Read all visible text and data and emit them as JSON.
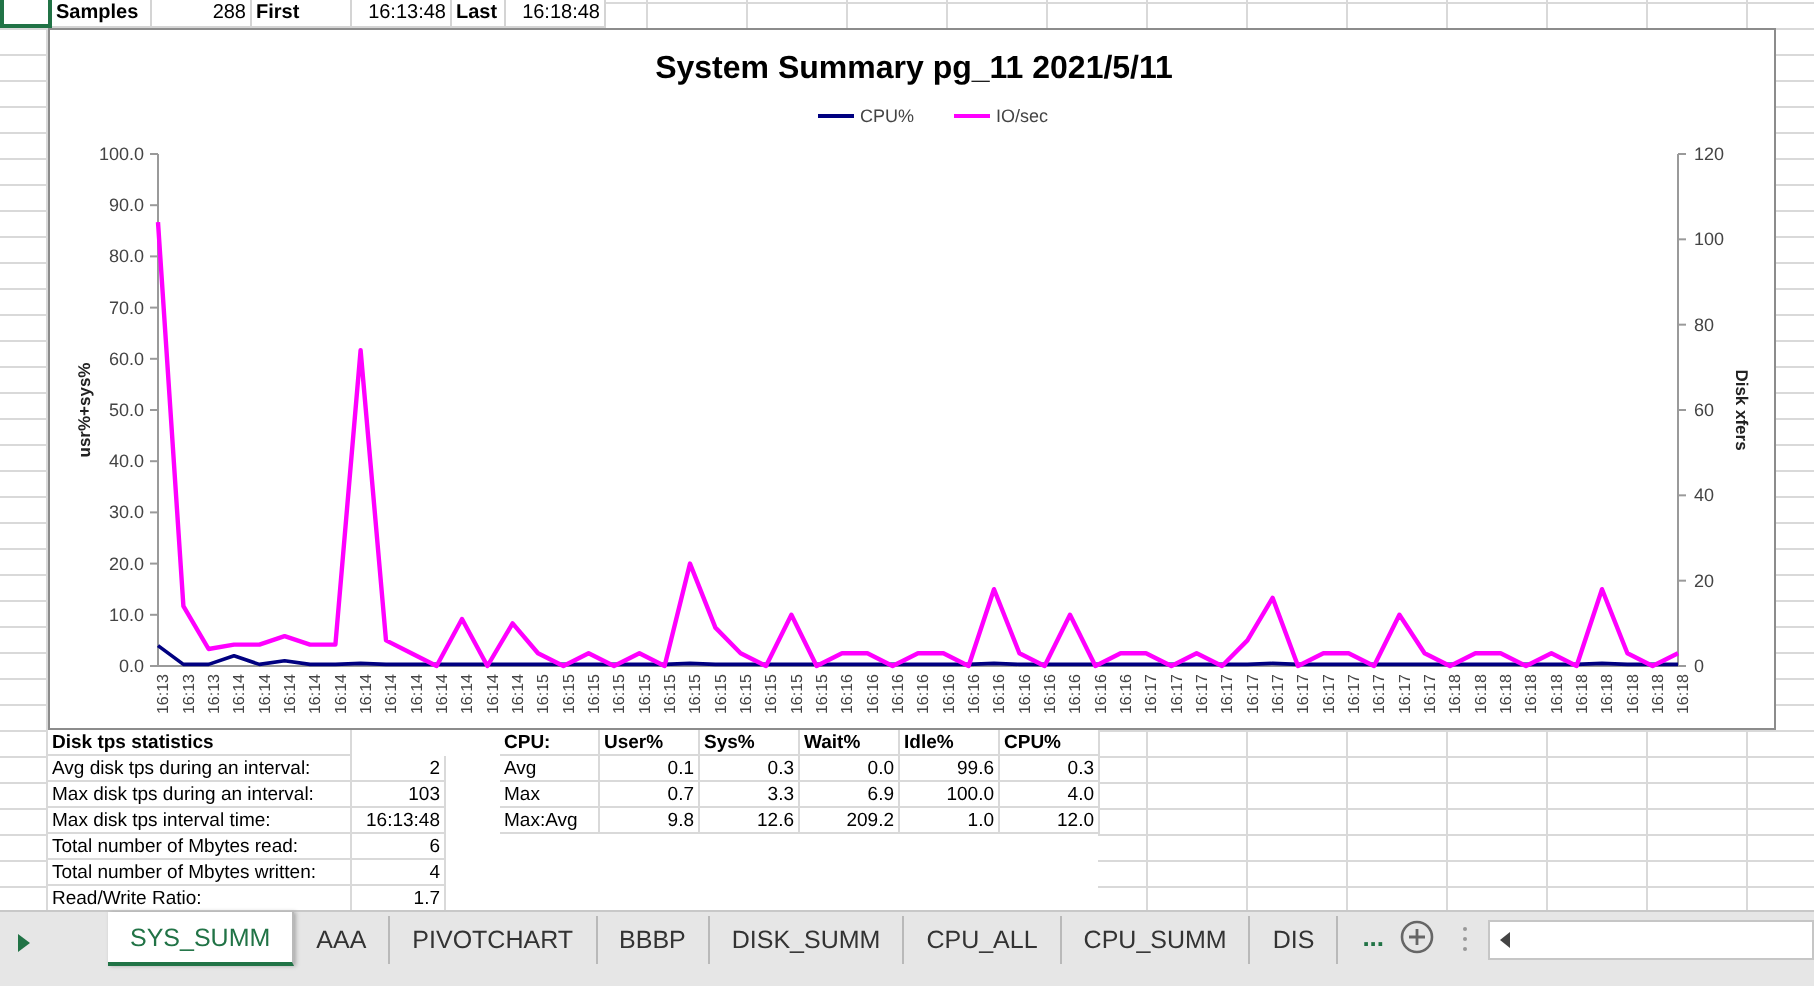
{
  "summary_row": [
    {
      "kind": "label",
      "text": "Samples"
    },
    {
      "kind": "value",
      "text": "288"
    },
    {
      "kind": "label",
      "text": "First"
    },
    {
      "kind": "value",
      "text": "16:13:48"
    },
    {
      "kind": "label",
      "text": "Last"
    },
    {
      "kind": "value",
      "text": "16:18:48"
    }
  ],
  "chart": {
    "chart_data": {
      "type": "line",
      "title": "System Summary pg_11  2021/5/11",
      "ylabel": "usr%+sys%",
      "ylim": [
        0,
        100
      ],
      "legend": "top",
      "y2label": "Disk xfers",
      "y2lim": [
        0,
        120
      ],
      "y2ticks": [
        0,
        20,
        40,
        60,
        80,
        100,
        120
      ],
      "yticks": [
        {
          "value": 0,
          "label": "0.0"
        },
        {
          "value": 10,
          "label": "10.0"
        },
        {
          "value": 20,
          "label": "20.0"
        },
        {
          "value": 30,
          "label": "30.0"
        },
        {
          "value": 40,
          "label": "40.0"
        },
        {
          "value": 50,
          "label": "50.0"
        },
        {
          "value": 60,
          "label": "60.0"
        },
        {
          "value": 70,
          "label": "70.0"
        },
        {
          "value": 80,
          "label": "80.0"
        },
        {
          "value": 90,
          "label": "90.0"
        },
        {
          "value": 100,
          "label": "100.0"
        }
      ],
      "categories": [
        "16:13",
        "16:13",
        "16:13",
        "16:14",
        "16:14",
        "16:14",
        "16:14",
        "16:14",
        "16:14",
        "16:14",
        "16:14",
        "16:14",
        "16:14",
        "16:14",
        "16:14",
        "16:15",
        "16:15",
        "16:15",
        "16:15",
        "16:15",
        "16:15",
        "16:15",
        "16:15",
        "16:15",
        "16:15",
        "16:15",
        "16:15",
        "16:16",
        "16:16",
        "16:16",
        "16:16",
        "16:16",
        "16:16",
        "16:16",
        "16:16",
        "16:16",
        "16:16",
        "16:16",
        "16:16",
        "16:17",
        "16:17",
        "16:17",
        "16:17",
        "16:17",
        "16:17",
        "16:17",
        "16:17",
        "16:17",
        "16:17",
        "16:17",
        "16:17",
        "16:18",
        "16:18",
        "16:18",
        "16:18",
        "16:18",
        "16:18",
        "16:18",
        "16:18",
        "16:18",
        "16:18"
      ],
      "series": [
        {
          "name": "CPU%",
          "color": "#000080",
          "values": [
            4,
            0.3,
            0.3,
            2,
            0.3,
            1,
            0.3,
            0.3,
            0.5,
            0.3,
            0.3,
            0.3,
            0.3,
            0.3,
            0.3,
            0.3,
            0.3,
            0.3,
            0.3,
            0.3,
            0.3,
            0.5,
            0.3,
            0.3,
            0.3,
            0.3,
            0.3,
            0.3,
            0.3,
            0.3,
            0.3,
            0.3,
            0.3,
            0.5,
            0.3,
            0.3,
            0.3,
            0.3,
            0.3,
            0.3,
            0.3,
            0.3,
            0.3,
            0.3,
            0.5,
            0.3,
            0.3,
            0.3,
            0.3,
            0.3,
            0.3,
            0.3,
            0.3,
            0.3,
            0.3,
            0.3,
            0.3,
            0.5,
            0.3,
            0.3,
            0.3
          ]
        },
        {
          "name": "IO/sec",
          "color": "#ff00ff",
          "axis": "y2",
          "values": [
            104,
            14,
            4,
            5,
            5,
            7,
            5,
            5,
            74,
            6,
            3,
            0,
            11,
            0,
            10,
            3,
            0,
            3,
            0,
            3,
            0,
            24,
            9,
            3,
            0,
            12,
            0,
            3,
            3,
            0,
            3,
            3,
            0,
            18,
            3,
            0,
            12,
            0,
            3,
            3,
            0,
            3,
            0,
            6,
            16,
            0,
            3,
            3,
            0,
            12,
            3,
            0,
            3,
            3,
            0,
            3,
            0,
            18,
            3,
            0,
            3
          ]
        }
      ]
    }
  },
  "disk_stats": {
    "title": "Disk tps statistics",
    "rows": [
      {
        "label": "Avg disk tps during an interval:",
        "value": "2"
      },
      {
        "label": "Max disk tps during an interval:",
        "value": "103"
      },
      {
        "label": "Max disk tps interval time:",
        "value": "16:13:48"
      },
      {
        "label": "Total number of Mbytes read:",
        "value": "6"
      },
      {
        "label": "Total number of Mbytes written:",
        "value": "4"
      },
      {
        "label": "Read/Write Ratio:",
        "value": "1.7"
      }
    ]
  },
  "cpu_stats": {
    "columns": [
      "CPU:",
      "User%",
      "Sys%",
      "Wait%",
      "Idle%",
      "CPU%"
    ],
    "rows": [
      [
        "Avg",
        "0.1",
        "0.3",
        "0.0",
        "99.6",
        "0.3"
      ],
      [
        "Max",
        "0.7",
        "3.3",
        "6.9",
        "100.0",
        "4.0"
      ],
      [
        "Max:Avg",
        "9.8",
        "12.6",
        "209.2",
        "1.0",
        "12.0"
      ]
    ]
  },
  "sheet_tabs": [
    {
      "label": "SYS_SUMM",
      "selected": true
    },
    {
      "label": "AAA",
      "selected": false
    },
    {
      "label": "PIVOTCHART",
      "selected": false
    },
    {
      "label": "BBBP",
      "selected": false
    },
    {
      "label": "DISK_SUMM",
      "selected": false
    },
    {
      "label": "CPU_ALL",
      "selected": false
    },
    {
      "label": "CPU_SUMM",
      "selected": false
    },
    {
      "label": "DIS",
      "selected": false
    }
  ],
  "tab_overflow": "..."
}
